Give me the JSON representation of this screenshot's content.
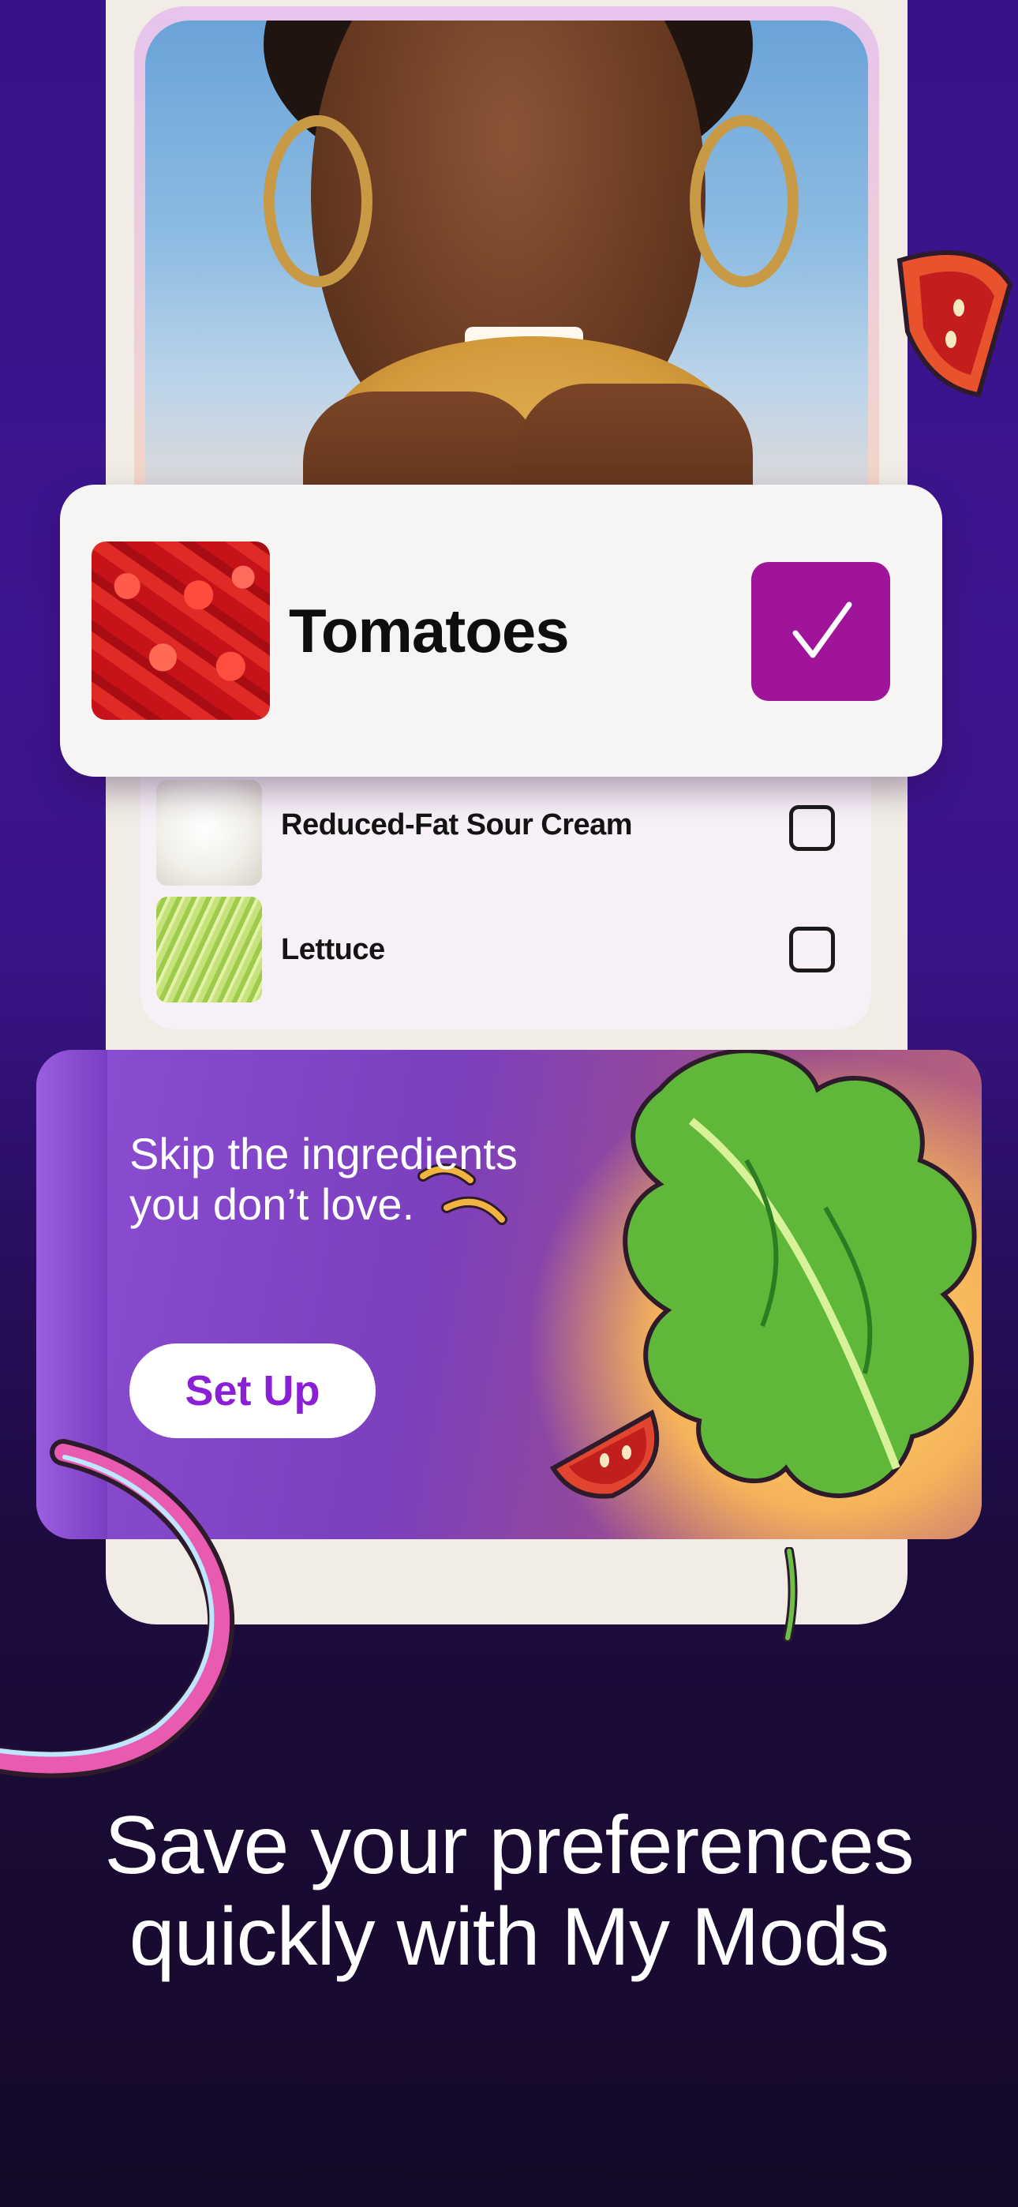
{
  "featured_item": {
    "label": "Tomatoes",
    "checked": true
  },
  "ingredients": [
    {
      "label": "Reduced-Fat Sour Cream",
      "checked": false,
      "thumb": "sour-cream"
    },
    {
      "label": "Lettuce",
      "checked": false,
      "thumb": "lettuce"
    }
  ],
  "promo": {
    "text": "Skip the ingredients you don’t love.",
    "button_label": "Set Up"
  },
  "caption": "Save your preferences quickly with My Mods",
  "colors": {
    "accent_purple": "#a0149a",
    "button_text": "#8b1fd6",
    "background_top": "#36138a",
    "background_bottom": "#150a28"
  },
  "icons": [
    "checkmark-icon",
    "checkbox-empty-icon",
    "tomato-slice-illustration",
    "lettuce-illustration",
    "onion-ring-illustration"
  ]
}
